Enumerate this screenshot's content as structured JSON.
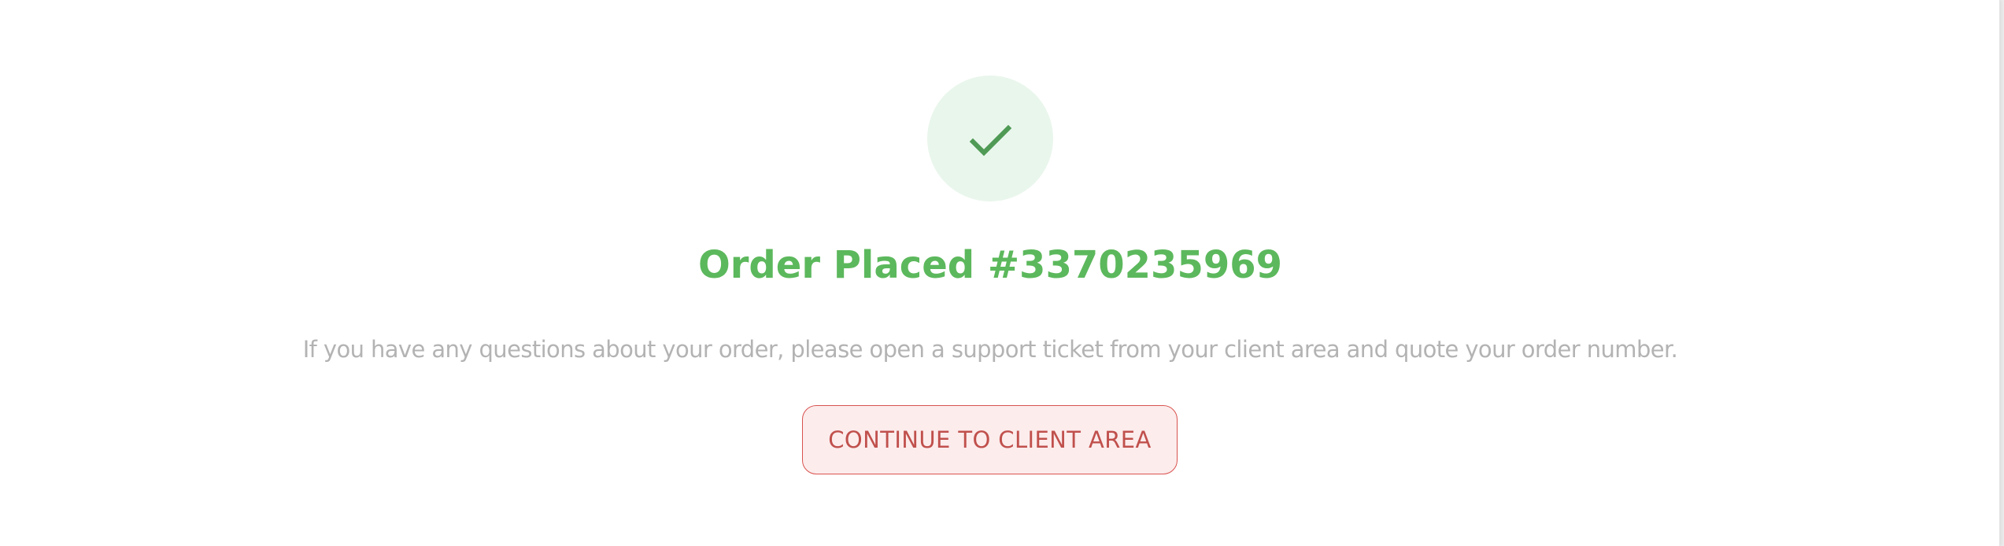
{
  "order_confirmation": {
    "icon": "checkmark-icon",
    "title": "Order Placed #3370235969",
    "message": "If you have any questions about your order, please open a support ticket from your client area and quote your order number.",
    "continue_button_label": "CONTINUE TO CLIENT AREA"
  },
  "colors": {
    "success_green": "#5cb85c",
    "success_circle_bg": "#e9f6ec",
    "checkmark": "#4f9a55",
    "message_text": "#b3b3b3",
    "button_border": "#d9534f",
    "button_bg": "#fcecec",
    "button_text": "#c0504c"
  }
}
